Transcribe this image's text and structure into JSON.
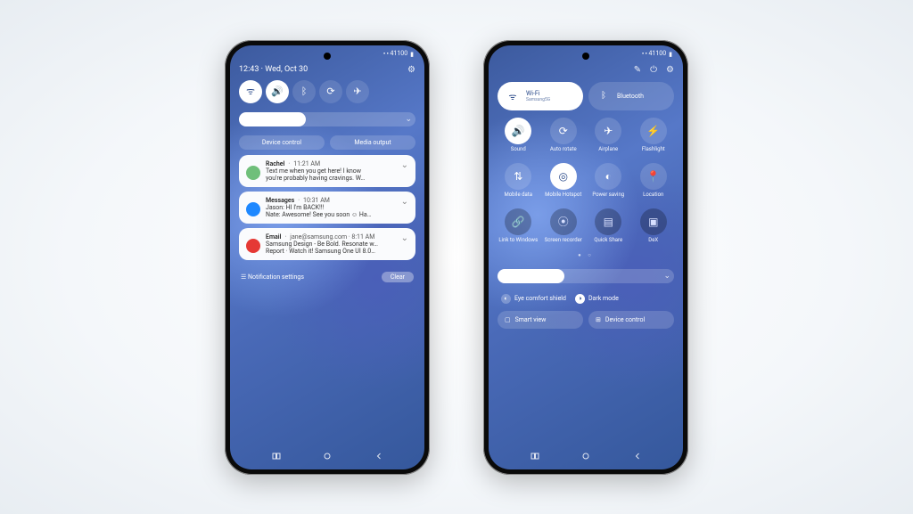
{
  "phone1": {
    "time": "12:43",
    "date": "Wed, Oct 30",
    "status_right": "⬝ ⬝ 41100",
    "quick": [
      {
        "name": "wifi-icon",
        "glyph": "ᯤ",
        "on": true
      },
      {
        "name": "volume-icon",
        "glyph": "🔊",
        "on": true
      },
      {
        "name": "bluetooth-icon",
        "glyph": "ᛒ",
        "on": false
      },
      {
        "name": "rotate-icon",
        "glyph": "⟳",
        "on": false
      },
      {
        "name": "airplane-icon",
        "glyph": "✈",
        "on": false
      }
    ],
    "brightness_pct": 38,
    "pills": {
      "device": "Device control",
      "media": "Media output"
    },
    "notifications": [
      {
        "app": "Rachel",
        "meta": "11:21 AM",
        "avatar": "#6fbf7a",
        "lines": [
          "Text me when you get here! I know",
          "you're probably having cravings. W…"
        ]
      },
      {
        "app": "Messages",
        "meta": "10:31 AM",
        "avatar": "#1e88ff",
        "lines": [
          "Jason: HI I'm BACK!!!",
          "Nate: Awesome! See you soon ☺ Ha…"
        ]
      },
      {
        "app": "Email",
        "meta": "jane@samsung.com · 8:11 AM",
        "avatar": "#e53935",
        "lines": [
          "Samsung Design - Be Bold. Resonate w…",
          "Report · Watch it! Samsung One UI 8.0…"
        ]
      }
    ],
    "footer": {
      "settings": "Notification settings",
      "clear": "Clear"
    }
  },
  "phone2": {
    "status_right": "⬝ ⬝ 41100",
    "wifi": {
      "label": "Wi-Fi",
      "sub": "Samsung5G"
    },
    "bluetooth": {
      "label": "Bluetooth"
    },
    "tiles": [
      {
        "name": "sound-icon",
        "glyph": "🔊",
        "label": "Sound",
        "state": "on"
      },
      {
        "name": "rotate-icon",
        "glyph": "⟳",
        "label": "Auto rotate",
        "state": "off"
      },
      {
        "name": "airplane-icon",
        "glyph": "✈",
        "label": "Airplane",
        "state": "off"
      },
      {
        "name": "flashlight-icon",
        "glyph": "⚡",
        "label": "Flashlight",
        "state": "off"
      },
      {
        "name": "mobile-data-icon",
        "glyph": "⇅",
        "label": "Mobile data",
        "state": "off"
      },
      {
        "name": "hotspot-icon",
        "glyph": "◎",
        "label": "Mobile Hotspot",
        "state": "on"
      },
      {
        "name": "power-icon",
        "glyph": "◐",
        "label": "Power saving",
        "state": "off"
      },
      {
        "name": "location-icon",
        "glyph": "📍",
        "label": "Location",
        "state": "off"
      },
      {
        "name": "link-icon",
        "glyph": "🔗",
        "label": "Link to Windows",
        "state": "dim"
      },
      {
        "name": "record-icon",
        "glyph": "⦿",
        "label": "Screen recorder",
        "state": "dim"
      },
      {
        "name": "qs-icon",
        "glyph": "▤",
        "label": "Quick Share",
        "state": "dim"
      },
      {
        "name": "dex-icon",
        "glyph": "▣",
        "label": "DeX",
        "state": "dim"
      }
    ],
    "brightness_pct": 38,
    "eye": "Eye comfort shield",
    "dark": "Dark mode",
    "smart": "Smart view",
    "device": "Device control"
  }
}
